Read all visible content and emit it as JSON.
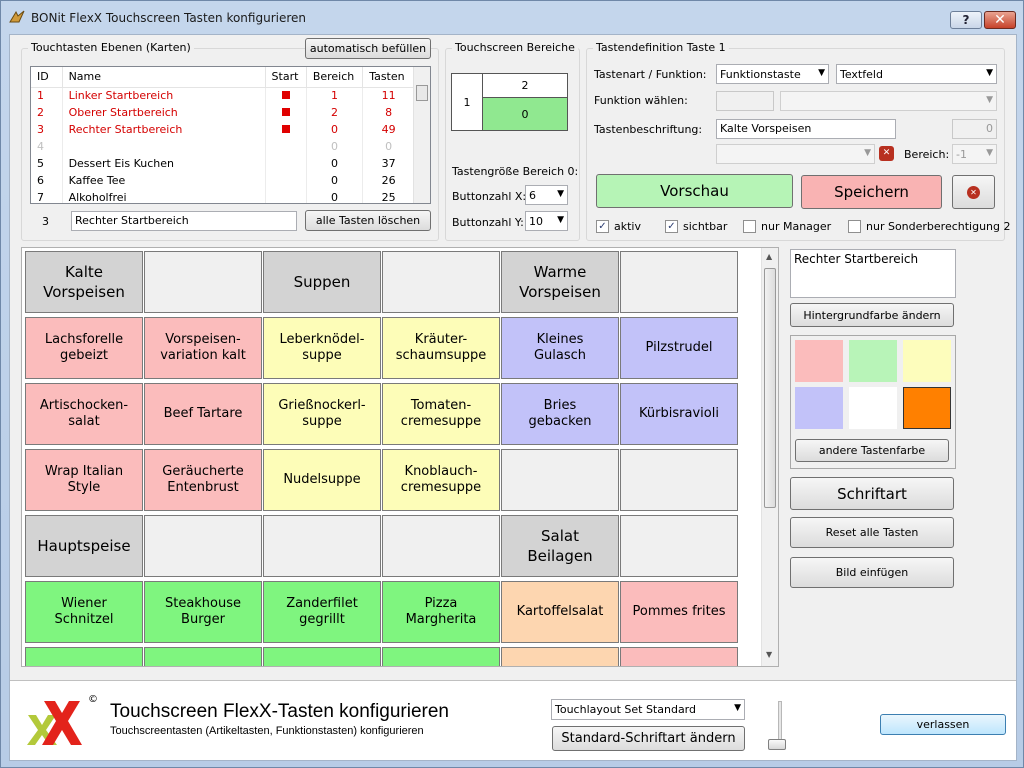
{
  "window": {
    "title": "BONit FlexX Touchscreen Tasten konfigurieren",
    "help_label": "?",
    "close_label": "✕"
  },
  "layers": {
    "group_label": "Touchtasten Ebenen (Karten)",
    "autofill_label": "automatisch befüllen",
    "columns": [
      "ID",
      "Name",
      "Start",
      "Bereich",
      "Tasten"
    ],
    "rows": [
      {
        "id": "1",
        "name": "Linker Startbereich",
        "start": true,
        "bereich": "1",
        "tasten": "11",
        "style": "red"
      },
      {
        "id": "2",
        "name": "Oberer Startbereich",
        "start": true,
        "bereich": "2",
        "tasten": "8",
        "style": "red"
      },
      {
        "id": "3",
        "name": "Rechter Startbereich",
        "start": true,
        "bereich": "0",
        "tasten": "49",
        "style": "red"
      },
      {
        "id": "4",
        "name": "",
        "start": false,
        "bereich": "0",
        "tasten": "0",
        "style": "gray"
      },
      {
        "id": "5",
        "name": "Dessert Eis Kuchen",
        "start": false,
        "bereich": "0",
        "tasten": "37",
        "style": "normal"
      },
      {
        "id": "6",
        "name": "Kaffee Tee",
        "start": false,
        "bereich": "0",
        "tasten": "26",
        "style": "normal"
      },
      {
        "id": "7",
        "name": "Alkoholfrei",
        "start": false,
        "bereich": "0",
        "tasten": "25",
        "style": "normal"
      }
    ],
    "selected_id": "3",
    "selected_name": "Rechter Startbereich",
    "delete_all_label": "alle Tasten löschen"
  },
  "areas": {
    "group_label": "Touchscreen Bereiche",
    "left_label": "1",
    "top_label": "2",
    "bottom_label": "0",
    "bottom_color": "#90e890",
    "size_label": "Tastengröße Bereich 0:",
    "x_label": "Buttonzahl X:",
    "x_value": "6",
    "y_label": "Buttonzahl Y:",
    "y_value": "10"
  },
  "keydef": {
    "group_label": "Tastendefinition Taste 1",
    "type_label": "Tastenart / Funktion:",
    "type_value": "Funktionstaste",
    "type2_value": "Textfeld",
    "func_label": "Funktion wählen:",
    "caption_label": "Tastenbeschriftung:",
    "caption_value": "Kalte Vorspeisen",
    "caption_num": "0",
    "bereich_label": "Bereich:",
    "bereich_value": "-1",
    "preview_label": "Vorschau",
    "preview_color": "#b6f4b6",
    "save_label": "Speichern",
    "save_color": "#f9b3b3",
    "checks": [
      {
        "label": "aktiv",
        "checked": true
      },
      {
        "label": "sichtbar",
        "checked": true
      },
      {
        "label": "nur Manager",
        "checked": false
      },
      {
        "label": "nur Sonderberechtigung 2",
        "checked": false
      }
    ]
  },
  "grid": {
    "rows": [
      [
        {
          "label": "Kalte\nVorspeisen",
          "color": "#d3d3d3",
          "big": true
        },
        {
          "label": "",
          "color": "#f0f0f0",
          "big": false
        },
        {
          "label": "Suppen",
          "color": "#d3d3d3",
          "big": true
        },
        {
          "label": "",
          "color": "#f0f0f0",
          "big": false
        },
        {
          "label": "Warme\nVorspeisen",
          "color": "#d3d3d3",
          "big": true
        },
        {
          "label": "",
          "color": "#f0f0f0",
          "big": false
        }
      ],
      [
        {
          "label": "Lachsforelle\ngebeizt",
          "color": "#fbbcbc",
          "big": false
        },
        {
          "label": "Vorspeisen-\nvariation kalt",
          "color": "#fbbcbc",
          "big": false
        },
        {
          "label": "Leberknödel-\nsuppe",
          "color": "#fdfdb8",
          "big": false
        },
        {
          "label": "Kräuter-\nschaumsuppe",
          "color": "#fdfdb8",
          "big": false
        },
        {
          "label": "Kleines\nGulasch",
          "color": "#c2c2f9",
          "big": false
        },
        {
          "label": "Pilzstrudel",
          "color": "#c2c2f9",
          "big": false
        }
      ],
      [
        {
          "label": "Artischocken-\nsalat",
          "color": "#fbbcbc",
          "big": false
        },
        {
          "label": "Beef Tartare",
          "color": "#fbbcbc",
          "big": false
        },
        {
          "label": "Grießnockerl-\nsuppe",
          "color": "#fdfdb8",
          "big": false
        },
        {
          "label": "Tomaten-\ncremesuppe",
          "color": "#fdfdb8",
          "big": false
        },
        {
          "label": "Bries\ngebacken",
          "color": "#c2c2f9",
          "big": false
        },
        {
          "label": "Kürbisravioli",
          "color": "#c2c2f9",
          "big": false
        }
      ],
      [
        {
          "label": "Wrap Italian\nStyle",
          "color": "#fbbcbc",
          "big": false
        },
        {
          "label": "Geräucherte\nEntenbrust",
          "color": "#fbbcbc",
          "big": false
        },
        {
          "label": "Nudelsuppe",
          "color": "#fdfdb8",
          "big": false
        },
        {
          "label": "Knoblauch-\ncremesuppe",
          "color": "#fdfdb8",
          "big": false
        },
        {
          "label": "",
          "color": "#f0f0f0",
          "big": false
        },
        {
          "label": "",
          "color": "#f0f0f0",
          "big": false
        }
      ],
      [
        {
          "label": "Hauptspeise",
          "color": "#d3d3d3",
          "big": true
        },
        {
          "label": "",
          "color": "#f0f0f0",
          "big": false
        },
        {
          "label": "",
          "color": "#f0f0f0",
          "big": false
        },
        {
          "label": "",
          "color": "#f0f0f0",
          "big": false
        },
        {
          "label": "Salat\nBeilagen",
          "color": "#d3d3d3",
          "big": true
        },
        {
          "label": "",
          "color": "#f0f0f0",
          "big": false
        }
      ],
      [
        {
          "label": "Wiener\nSchnitzel",
          "color": "#7ff57f",
          "big": false
        },
        {
          "label": "Steakhouse\nBurger",
          "color": "#7ff57f",
          "big": false
        },
        {
          "label": "Zanderfilet\ngegrillt",
          "color": "#7ff57f",
          "big": false
        },
        {
          "label": "Pizza\nMargherita",
          "color": "#7ff57f",
          "big": false
        },
        {
          "label": "Kartoffelsalat",
          "color": "#fdd6b0",
          "big": false
        },
        {
          "label": "Pommes frites",
          "color": "#fbbcbc",
          "big": false
        }
      ],
      [
        {
          "label": "",
          "color": "#7ff57f",
          "big": false
        },
        {
          "label": "",
          "color": "#7ff57f",
          "big": false
        },
        {
          "label": "",
          "color": "#7ff57f",
          "big": false
        },
        {
          "label": "",
          "color": "#7ff57f",
          "big": false
        },
        {
          "label": "",
          "color": "#fdd6b0",
          "big": false
        },
        {
          "label": "",
          "color": "#fbbcbc",
          "big": false
        }
      ]
    ]
  },
  "right_panel": {
    "name_value": "Rechter Startbereich",
    "bg_color_label": "Hintergrundfarbe ändern",
    "palette": [
      "#fbbcbc",
      "#b8f4b8",
      "#fdfdbc",
      "#c2c2f9",
      "#ffffff",
      "#ff8000"
    ],
    "other_color_label": "andere Tastenfarbe",
    "font_label": "Schriftart",
    "reset_label": "Reset alle Tasten",
    "image_label": "Bild einfügen"
  },
  "footer": {
    "heading": "Touchscreen FlexX-Tasten konfigurieren",
    "subheading": "Touchscreentasten (Artikeltasten, Funktionstasten) konfigurieren",
    "layout_value": "Touchlayout Set Standard",
    "font_default_label": "Standard-Schriftart ändern",
    "exit_label": "verlassen",
    "logo_mark": "©"
  }
}
